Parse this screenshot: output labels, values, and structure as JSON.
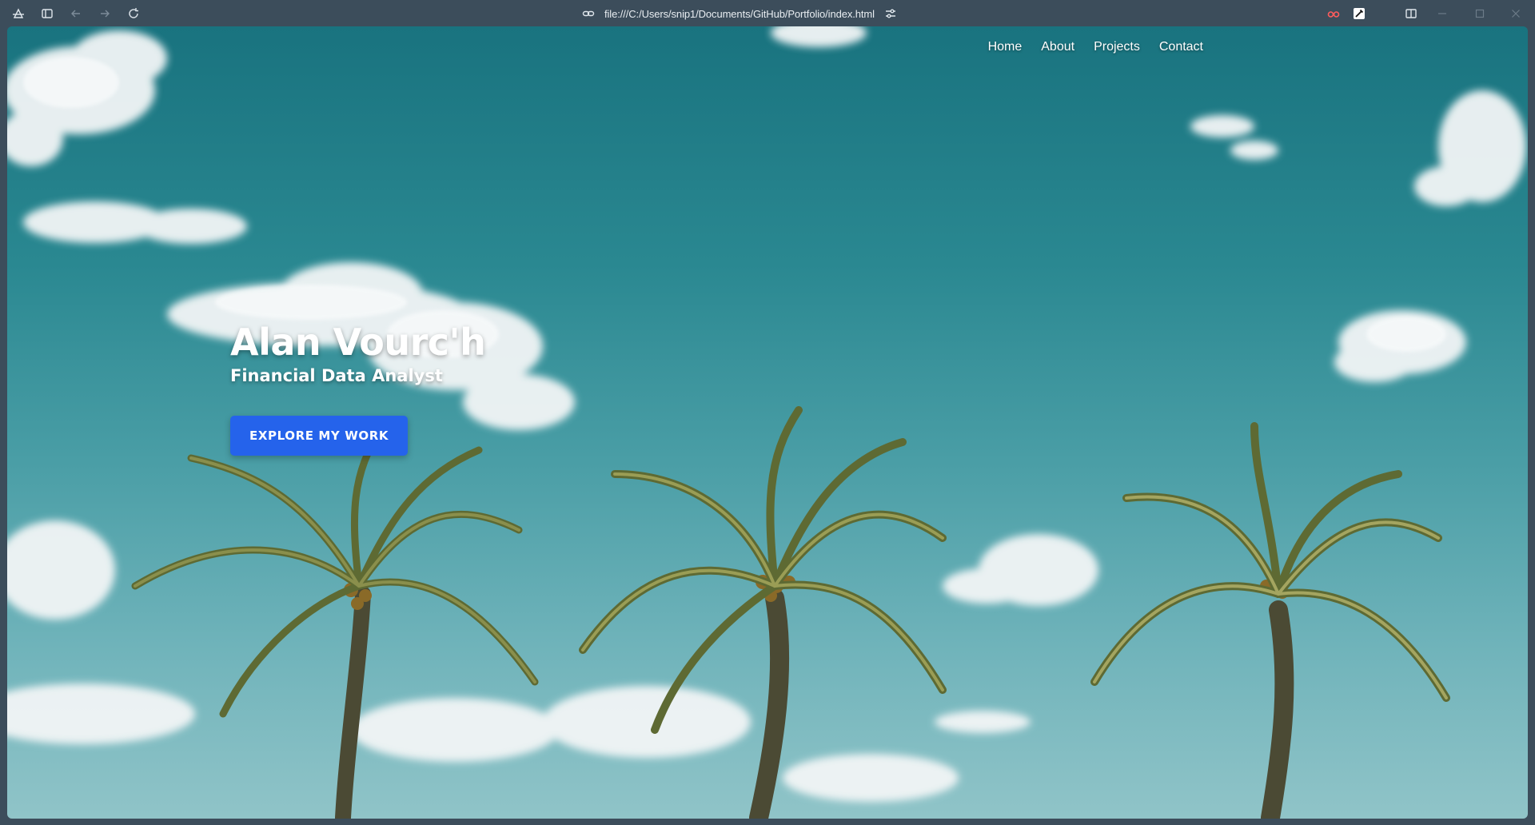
{
  "browser": {
    "url": "file:///C:/Users/snip1/Documents/GitHub/Portfolio/index.html",
    "icons": [
      "workspaces-icon",
      "sidebar-icon",
      "back-icon",
      "forward-icon",
      "reload-icon",
      "link-icon",
      "site-settings-icon",
      "extension-glasses-icon",
      "extension-pen-icon",
      "extension-moon-icon",
      "split-view-icon",
      "minimize-icon",
      "maximize-icon",
      "close-icon"
    ]
  },
  "nav": {
    "items": [
      {
        "label": "Home"
      },
      {
        "label": "About"
      },
      {
        "label": "Projects"
      },
      {
        "label": "Contact"
      }
    ]
  },
  "hero": {
    "title": "Alan Vourc'h",
    "subtitle": "Financial Data Analyst",
    "cta_label": "Explore My Work"
  },
  "colors": {
    "accent": "#2563eb",
    "sky_top": "#19737f",
    "sky_bottom": "#90c4c8",
    "browser_chrome": "#3c4d5b"
  }
}
